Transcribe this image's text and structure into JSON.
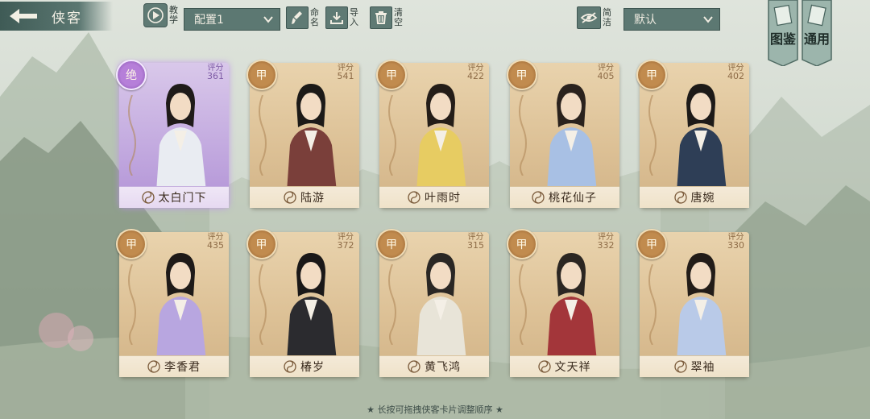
{
  "header": {
    "back_icon": "back-arrow-icon",
    "title": "侠客",
    "tutorial_label": "教学",
    "config_select": "配置1",
    "rename_label": "命名",
    "import_label": "导入",
    "clear_label": "清空",
    "simple_label": "简洁",
    "sort_select": "默认",
    "codex_label": "图鉴",
    "general_label": "通用"
  },
  "score_label": "评分",
  "cards": [
    {
      "grade": "绝",
      "score": "361",
      "name": "太白门下",
      "rarity": "purple"
    },
    {
      "grade": "甲",
      "score": "541",
      "name": "陆游",
      "rarity": "gold"
    },
    {
      "grade": "甲",
      "score": "422",
      "name": "叶雨时",
      "rarity": "gold"
    },
    {
      "grade": "甲",
      "score": "405",
      "name": "桃花仙子",
      "rarity": "gold"
    },
    {
      "grade": "甲",
      "score": "402",
      "name": "唐婉",
      "rarity": "gold"
    },
    {
      "grade": "甲",
      "score": "435",
      "name": "李香君",
      "rarity": "gold"
    },
    {
      "grade": "甲",
      "score": "372",
      "name": "椿岁",
      "rarity": "gold"
    },
    {
      "grade": "甲",
      "score": "315",
      "name": "黄飞鸿",
      "rarity": "gold"
    },
    {
      "grade": "甲",
      "score": "332",
      "name": "文天祥",
      "rarity": "gold"
    },
    {
      "grade": "甲",
      "score": "330",
      "name": "翠袖",
      "rarity": "gold"
    }
  ],
  "footer_hint": "★ 长按可拖拽侠客卡片调整顺序 ★",
  "colors": {
    "accent": "#5c7872",
    "card_gold": "#dcc095",
    "card_purple": "#c2a9df",
    "grade_gold": "#c18b4e"
  }
}
